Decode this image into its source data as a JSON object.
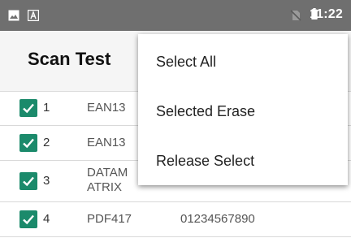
{
  "status_bar": {
    "time": "11:22",
    "icons": [
      "image-icon",
      "a-letter-icon",
      "no-sim-icon",
      "battery-icon"
    ],
    "bg_color": "#6f6f6f"
  },
  "app_bar": {
    "title": "Scan Test"
  },
  "rows": [
    {
      "checked": true,
      "num": "1",
      "type": "EAN13",
      "value": ""
    },
    {
      "checked": true,
      "num": "2",
      "type": "EAN13",
      "value": ""
    },
    {
      "checked": true,
      "num": "3",
      "type": "DATAMATRIX",
      "value": ""
    },
    {
      "checked": true,
      "num": "4",
      "type": "PDF417",
      "value": "01234567890"
    }
  ],
  "menu": {
    "items": [
      "Select All",
      "Selected Erase",
      "Release Select"
    ]
  },
  "colors": {
    "checkbox": "#1b8a6b"
  }
}
